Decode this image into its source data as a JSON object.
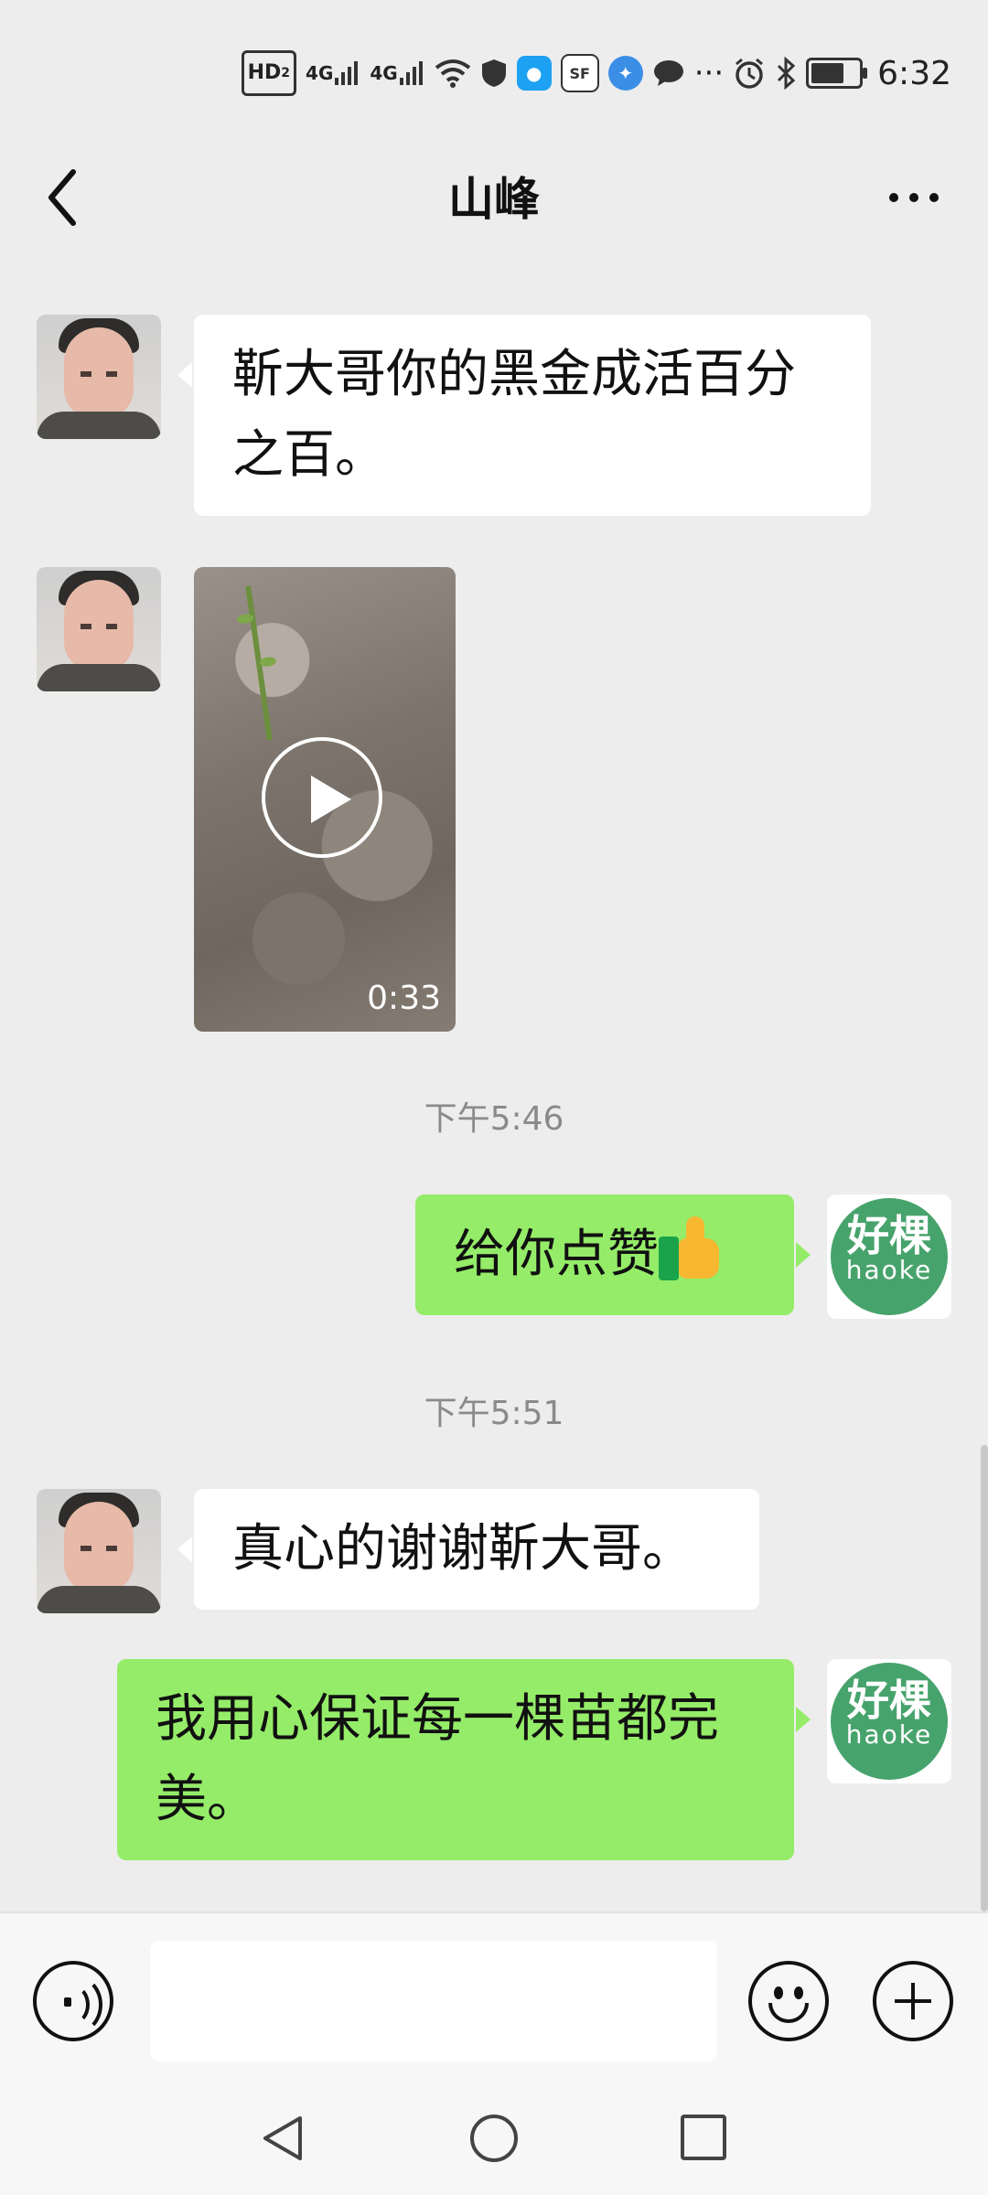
{
  "status_bar": {
    "hd_label": "HD",
    "hd_sub": "2",
    "network_1": "4G",
    "network_2": "4G",
    "app_icons": [
      "lightbulb-app-icon",
      "sf-express-icon",
      "browser-icon",
      "chat-icon"
    ],
    "more_label": "···",
    "battery_level": 0.7,
    "time": "6:32"
  },
  "header": {
    "title": "山峰"
  },
  "messages": [
    {
      "sender": "other",
      "type": "text",
      "text": "靳大哥你的黑金成活百分之百。"
    },
    {
      "sender": "other",
      "type": "video",
      "duration": "0:33"
    },
    {
      "type": "timestamp",
      "text": "下午5:46"
    },
    {
      "sender": "self",
      "type": "text",
      "text": "给你点赞",
      "emoji": "thumbs-up"
    },
    {
      "type": "timestamp",
      "text": "下午5:51"
    },
    {
      "sender": "other",
      "type": "text",
      "text": "真心的谢谢靳大哥。"
    },
    {
      "sender": "self",
      "type": "text",
      "text": "我用心保证每一棵苗都完美。"
    }
  ],
  "self_avatar": {
    "cn": "好棵",
    "en": "haoke"
  },
  "colors": {
    "self_bubble": "#95ec69",
    "other_bubble": "#ffffff",
    "background": "#ededed",
    "avatar_brand": "#47a36c"
  },
  "input": {
    "value": "",
    "placeholder": ""
  }
}
